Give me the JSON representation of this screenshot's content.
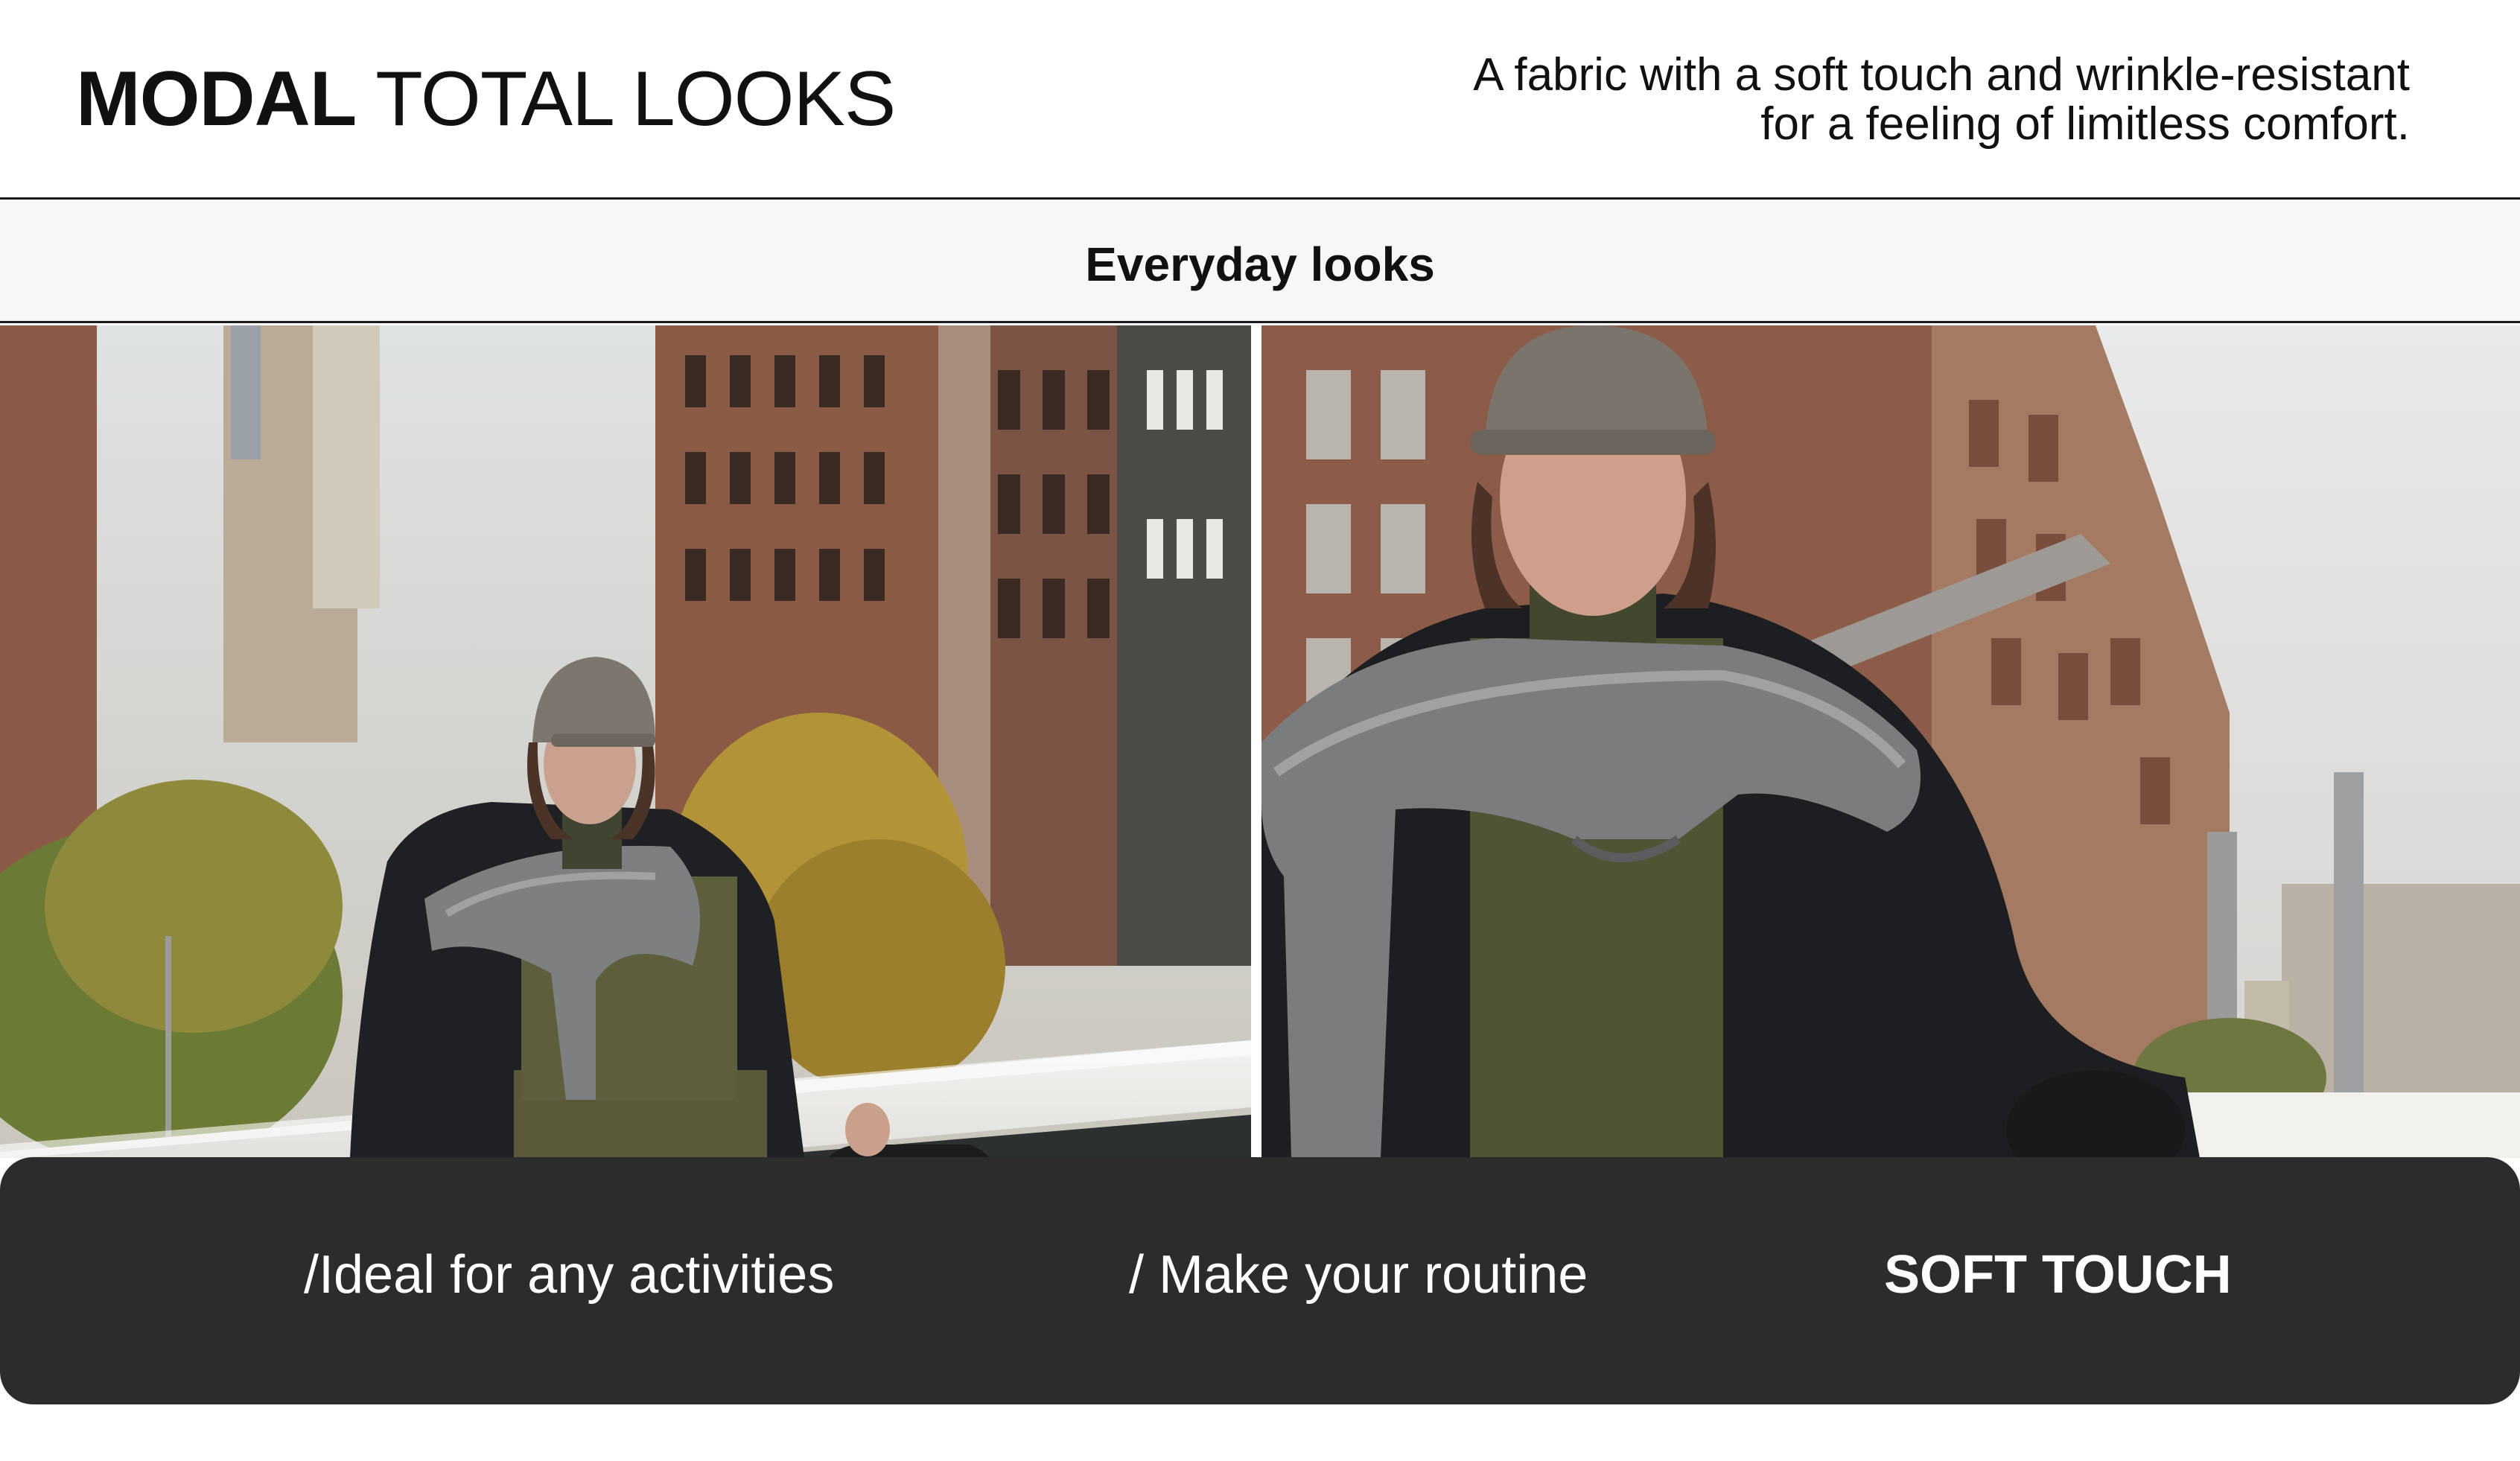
{
  "header": {
    "brand_strong": "MODAL",
    "brand_light": "TOTAL LOOKS",
    "tagline_line1": "A fabric with a soft touch and wrinkle-resistant",
    "tagline_line2": "for a feeling of limitless comfort."
  },
  "section": {
    "title": "Everyday looks"
  },
  "photos": [
    {
      "name": "look-photo-street-full-length"
    },
    {
      "name": "look-photo-street-close-up"
    }
  ],
  "features": [
    {
      "label": "/Ideal for any activities"
    },
    {
      "label": "/ Make your routine"
    },
    {
      "label": "SOFT TOUCH"
    }
  ],
  "colors": {
    "background": "#ffffff",
    "subbar_background": "#f8f7f5",
    "feature_bar": "#2c2c2c",
    "text_dark": "#111111",
    "text_light": "#ffffff"
  }
}
